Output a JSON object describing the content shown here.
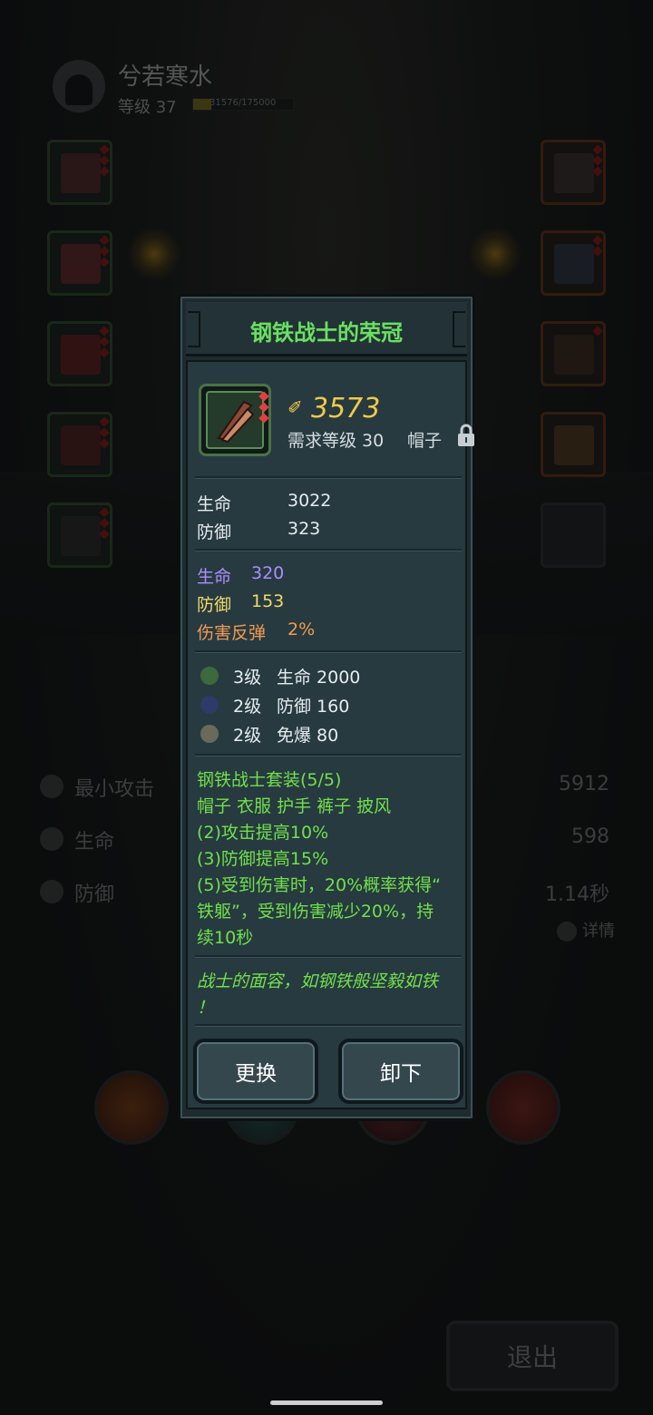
{
  "player": {
    "name": "兮若寒水",
    "level_text": "等级 37",
    "xp_text": "31576/175000",
    "xp_fraction": 0.18
  },
  "background_stats": [
    {
      "label": "最小攻击",
      "value": "5912"
    },
    {
      "label": "生命",
      "value": "598"
    },
    {
      "label": "防御",
      "value": "1.14秒"
    }
  ],
  "detail_label": "详情",
  "exit_label": "退出",
  "item": {
    "title": "钢铁战士的荣冠",
    "score": "3573",
    "required_level": "需求等级 30",
    "slot": "帽子",
    "base_stats": [
      {
        "label": "生命",
        "value": "3022"
      },
      {
        "label": "防御",
        "value": "323"
      }
    ],
    "extra_stats": [
      {
        "label": "生命",
        "value": "320",
        "color": "#b08cff"
      },
      {
        "label": "防御",
        "value": "153",
        "color": "#f2d86a"
      },
      {
        "label": "伤害反弹",
        "value": "2%",
        "color": "#f29a52"
      }
    ],
    "gems": [
      {
        "level": "3级",
        "effect": "生命 2000",
        "color": "#5aa05a"
      },
      {
        "level": "2级",
        "effect": "防御 160",
        "color": "#4a5aa0"
      },
      {
        "level": "2级",
        "effect": "免爆 80",
        "color": "#a0a090"
      }
    ],
    "set": {
      "name": "钢铁战士套装(5/5)",
      "pieces": "帽子 衣服 护手 裤子 披风",
      "bonus2": "(2)攻击提高10%",
      "bonus3": "(3)防御提高15%",
      "bonus5_line1": "(5)受到伤害时，20%概率获得“",
      "bonus5_line2": "铁躯”，受到伤害减少20%，持",
      "bonus5_line3": "续10秒"
    },
    "flavor_line1": "战士的面容，如钢铁般坚毅如铁",
    "flavor_line2": "！",
    "replace_label": "更换",
    "unequip_label": "卸下"
  },
  "colors": {
    "title_green": "#69e060",
    "set_green": "#72e04a",
    "score_gold": "#f2c94a"
  }
}
